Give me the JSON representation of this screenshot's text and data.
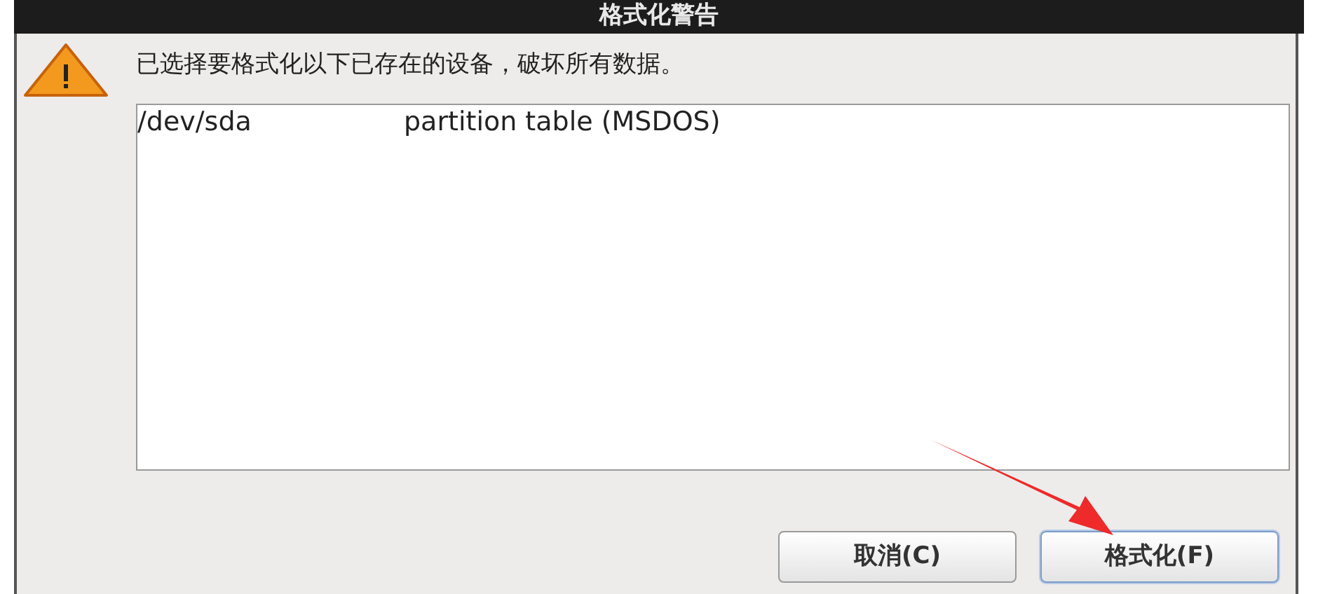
{
  "window": {
    "title": "格式化警告"
  },
  "message": "已选择要格式化以下已存在的设备，破坏所有数据。",
  "devices": [
    {
      "device": "/dev/sda",
      "description": "partition table (MSDOS)"
    }
  ],
  "buttons": [
    {
      "label": "取消(C)",
      "focused": false
    },
    {
      "label": "格式化(F)",
      "focused": true
    }
  ]
}
